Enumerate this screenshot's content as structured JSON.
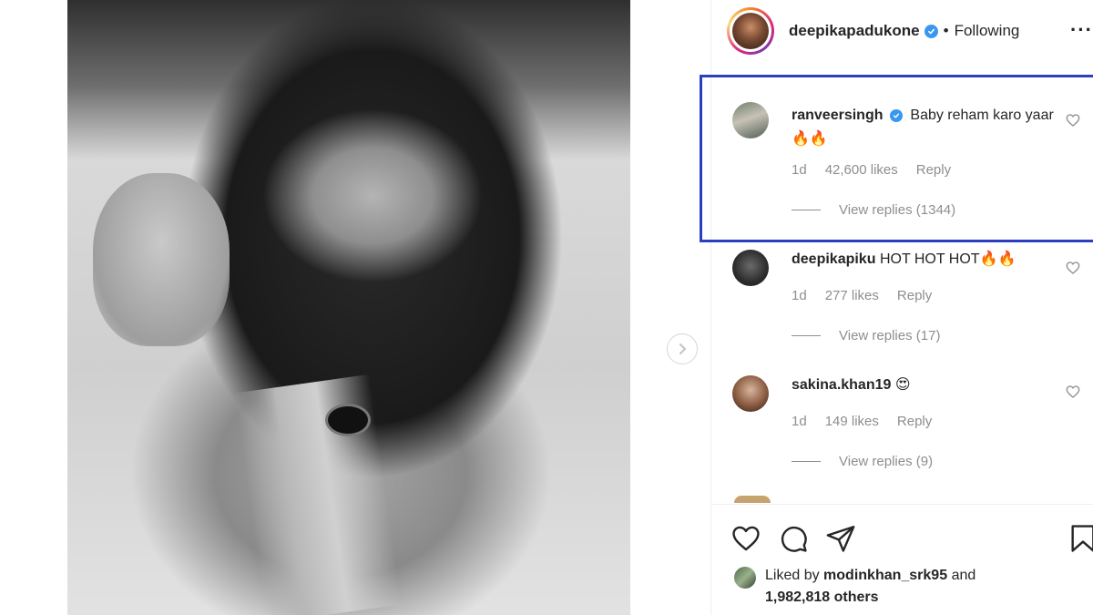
{
  "post": {
    "author": "deepikapadukone",
    "separator": "•",
    "follow_state": "Following",
    "more_label": "···"
  },
  "comments": [
    {
      "user": "ranveersingh",
      "text": "Baby reham karo yaar 🔥🔥",
      "age": "1d",
      "likes": "42,600 likes",
      "reply": "Reply",
      "view_replies": "View replies (1344)",
      "verified": true,
      "highlighted": true
    },
    {
      "user": "deepikapiku",
      "text": "HOT HOT HOT🔥🔥",
      "age": "1d",
      "likes": "277 likes",
      "reply": "Reply",
      "view_replies": "View replies (17)"
    },
    {
      "user": "sakina.khan19",
      "text": "😍",
      "age": "1d",
      "likes": "149 likes",
      "reply": "Reply",
      "view_replies": "View replies (9)"
    }
  ],
  "liked_by": {
    "prefix": "Liked by",
    "user": "modinkhan_srk95",
    "middle": "and",
    "count": "1,982,818 others"
  },
  "colors": {
    "highlight_border": "#2b3fc0",
    "verified_blue": "#3897f0",
    "meta_gray": "#8e8e8e"
  },
  "icons": [
    "chevron-right-icon",
    "verified-icon",
    "heart-icon",
    "comment-icon",
    "share-icon",
    "bookmark-icon"
  ]
}
